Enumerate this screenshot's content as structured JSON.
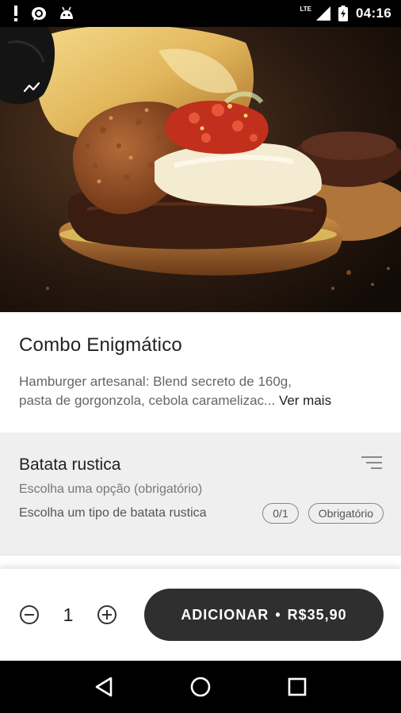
{
  "status_bar": {
    "time": "04:16",
    "network": "LTE",
    "left_icons": [
      "alert-icon",
      "chat-sync-icon",
      "android-icon"
    ],
    "right_icons": [
      "signal-icon",
      "battery-charging-icon"
    ]
  },
  "hero": {
    "image_subject": "gourmet burger with crispy cheese crust, tomato salsa and melted cheese",
    "back_icon": "chevron-down-icon"
  },
  "product": {
    "title": "Combo Enigmático",
    "description_line1": "Hamburger artesanal: Blend secreto de 160g,",
    "description_line2": "pasta de gorgonzola, cebola caramelizac...",
    "see_more": "Ver mais"
  },
  "options": {
    "title": "Batata rustica",
    "subtitle": "Escolha uma opção (obrigatório)",
    "description": "Escolha um tipo de batata rustica",
    "counter": "0/1",
    "required_badge": "Obrigatório",
    "filter_icon": "sort-lines-icon"
  },
  "order": {
    "quantity": "1",
    "decrement_icon": "minus-circle-icon",
    "increment_icon": "plus-circle-icon",
    "add_label": "ADICIONAR",
    "separator": "•",
    "price": "R$35,90"
  },
  "nav": {
    "back_icon": "triangle-back-icon",
    "home_icon": "circle-home-icon",
    "recents_icon": "square-recents-icon"
  },
  "colors": {
    "button_bg": "#2f2f2f",
    "section_bg": "#efefef",
    "status_bg": "#000000"
  }
}
